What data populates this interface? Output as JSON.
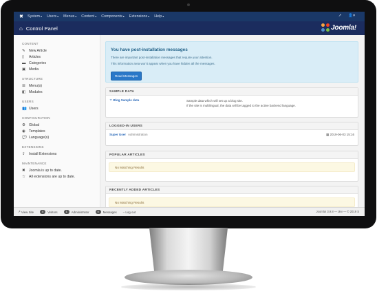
{
  "topmenu": {
    "items": [
      "System",
      "Users",
      "Menus",
      "Content",
      "Components",
      "Extensions",
      "Help"
    ],
    "right_icons": [
      "external-link-icon",
      "user-icon"
    ]
  },
  "header": {
    "title": "Control Panel",
    "brand": "Joomla!"
  },
  "sidebar": {
    "content": {
      "heading": "CONTENT",
      "items": [
        "New Article",
        "Articles",
        "Categories",
        "Media"
      ]
    },
    "structure": {
      "heading": "STRUCTURE",
      "items": [
        "Menu(s)",
        "Modules"
      ]
    },
    "users": {
      "heading": "USERS",
      "items": [
        "Users"
      ]
    },
    "configuration": {
      "heading": "CONFIGURATION",
      "items": [
        "Global",
        "Templates",
        "Language(s)"
      ]
    },
    "extensions": {
      "heading": "EXTENSIONS",
      "items": [
        "Install Extensions"
      ]
    },
    "maintenance": {
      "heading": "MAINTENANCE",
      "items": [
        "Joomla is up to date.",
        "All extensions are up to date."
      ]
    }
  },
  "alert": {
    "title": "You have post-installation messages",
    "line1": "There are important post-installation messages that require your attention.",
    "line2": "This information area won't appear when you have hidden all the messages.",
    "button": "Read Messages"
  },
  "sample_data": {
    "heading": "SAMPLE DATA",
    "link": "Blog Sample data",
    "desc1": "Sample data which will set up a blog site.",
    "desc2": "If the site is multilingual, the data will be tagged to the active backend language."
  },
  "logged_in": {
    "heading": "LOGGED-IN USERS",
    "user": "Super User",
    "role": "Administration",
    "date": "2019-06-03 15:16"
  },
  "popular": {
    "heading": "POPULAR ARTICLES",
    "empty": "No Matching Results"
  },
  "recent": {
    "heading": "RECENTLY ADDED ARTICLES",
    "empty": "No Matching Results"
  },
  "statusbar": {
    "view_site": "View Site",
    "visitors_count": "0",
    "visitors": "Visitors",
    "admins_count": "1",
    "admins": "Administrator",
    "messages_count": "0",
    "messages": "Messages",
    "logout": "Log out",
    "version": "Joomla! 3.9.8 — dev — © 2019 S"
  },
  "colors": {
    "topbar": "#1a3867",
    "header": "#1b2c5e",
    "alert_bg": "#d9edf7",
    "button": "#2a78c8"
  }
}
